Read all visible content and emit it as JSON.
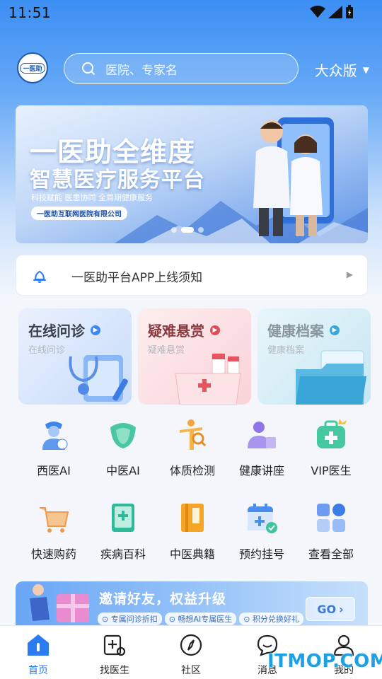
{
  "status_bar": {
    "time": "11:51"
  },
  "header": {
    "logo_text": "一医助",
    "search_placeholder": "医院、专家名",
    "version_label": "大众版",
    "version_caret": "▼"
  },
  "banner": {
    "title_line1": "一医助全维度",
    "title_line2": "智慧医疗服务平台",
    "subtitle": "科技赋能 医患协同 全周期健康服务",
    "company_tag": "一医助互联网医院有限公司"
  },
  "notice": {
    "text": "一医助平台APP上线须知",
    "arrow": "▶"
  },
  "feature_cards": [
    {
      "title": "在线问诊",
      "subtitle": "在线问诊",
      "title_color": "#3a3f4a",
      "accent": "#3d86f0"
    },
    {
      "title": "疑难悬赏",
      "subtitle": "疑难悬赏",
      "title_color": "#8a3a40",
      "accent": "#e24b59"
    },
    {
      "title": "健康档案",
      "subtitle": "健康档案",
      "title_color": "#8a969e",
      "accent": "#38a9d6"
    }
  ],
  "shortcuts": [
    {
      "label": "西医AI",
      "icon": "doctor-ai-icon"
    },
    {
      "label": "中医AI",
      "icon": "tongue-icon"
    },
    {
      "label": "体质检测",
      "icon": "body-check-icon"
    },
    {
      "label": "健康讲座",
      "icon": "lecture-icon"
    },
    {
      "label": "VIP医生",
      "icon": "vip-kit-icon"
    },
    {
      "label": "快速购药",
      "icon": "cart-icon"
    },
    {
      "label": "疾病百科",
      "icon": "encyclopedia-icon"
    },
    {
      "label": "中医典籍",
      "icon": "classic-book-icon"
    },
    {
      "label": "预约挂号",
      "icon": "calendar-icon"
    },
    {
      "label": "查看全部",
      "icon": "all-apps-icon"
    }
  ],
  "invite": {
    "title": "邀请好友，权益升级",
    "tags": [
      "专属问诊折扣",
      "畅想AI专属医生",
      "积分兑换好礼"
    ],
    "go_label": "GO"
  },
  "tabbar": [
    {
      "label": "首页",
      "icon": "home-icon",
      "active": true
    },
    {
      "label": "找医生",
      "icon": "find-doctor-icon",
      "active": false
    },
    {
      "label": "社区",
      "icon": "compass-icon",
      "active": false
    },
    {
      "label": "消息",
      "icon": "message-icon",
      "active": false
    },
    {
      "label": "我的",
      "icon": "profile-icon",
      "active": false
    }
  ],
  "watermark": "ITMOP.COM",
  "colors": {
    "primary": "#2b7cf0",
    "header_blue": "#3b8ef3"
  }
}
